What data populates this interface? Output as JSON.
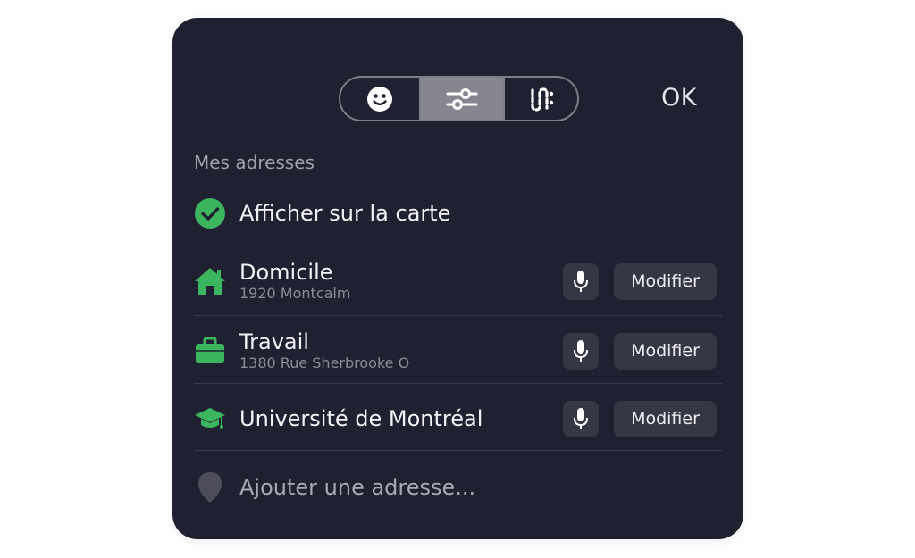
{
  "header": {
    "segments": [
      {
        "icon": "smiley-face-icon"
      },
      {
        "icon": "sliders-icon",
        "selected": true
      },
      {
        "icon": "transit-route-icon"
      }
    ],
    "ok_label": "OK"
  },
  "section": {
    "title": "Mes adresses"
  },
  "show_on_map": {
    "label": "Afficher sur la carte",
    "checked": true,
    "icon": "check-circle-icon"
  },
  "addresses": [
    {
      "icon": "home-icon",
      "name": "Domicile",
      "detail": "1920 Montcalm",
      "modify_label": "Modifier",
      "mic_icon": "microphone-icon"
    },
    {
      "icon": "briefcase-icon",
      "name": "Travail",
      "detail": "1380 Rue Sherbrooke O",
      "modify_label": "Modifier",
      "mic_icon": "microphone-icon"
    },
    {
      "icon": "graduation-cap-icon",
      "name": "Université de Montréal",
      "detail": "",
      "modify_label": "Modifier",
      "mic_icon": "microphone-icon"
    }
  ],
  "add_address": {
    "label": "Ajouter une adresse...",
    "icon": "map-pin-icon"
  },
  "colors": {
    "panel_bg": "#1f2030",
    "accent_green": "#3cb55f",
    "button_bg": "#363745",
    "selected_segment": "#858690"
  }
}
